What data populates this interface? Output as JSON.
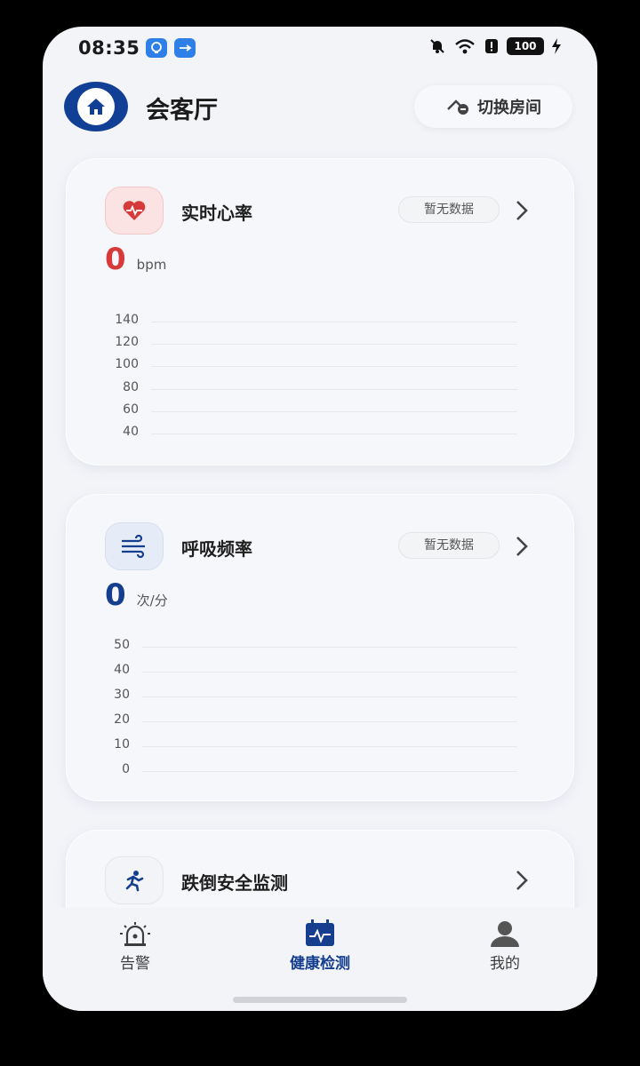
{
  "status_bar": {
    "time": "08:35",
    "battery": "100"
  },
  "header": {
    "room_title": "会客厅",
    "switch_room_label": "切换房间"
  },
  "heart_card": {
    "title": "实时心率",
    "badge": "暂无数据",
    "value": "0",
    "unit": "bpm",
    "accent": "#d63a3a",
    "y_ticks": [
      "140",
      "120",
      "100",
      "80",
      "60",
      "40"
    ]
  },
  "breath_card": {
    "title": "呼吸频率",
    "badge": "暂无数据",
    "value": "0",
    "unit": "次/分",
    "accent": "#163e8f",
    "y_ticks": [
      "50",
      "40",
      "30",
      "20",
      "10",
      "0"
    ]
  },
  "fall_card": {
    "title": "跌倒安全监测"
  },
  "bottom_nav": {
    "items": [
      {
        "label": "告警",
        "icon": "alarm-light-icon"
      },
      {
        "label": "健康检测",
        "icon": "calendar-pulse-icon",
        "active": true
      },
      {
        "label": "我的",
        "icon": "person-icon"
      }
    ]
  }
}
